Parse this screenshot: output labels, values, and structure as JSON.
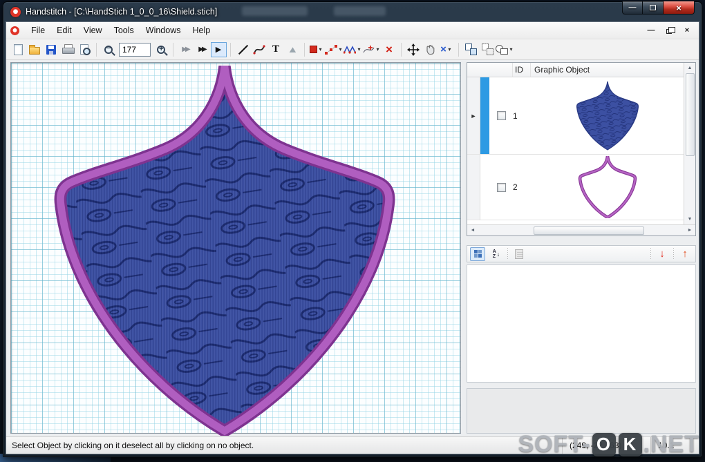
{
  "window": {
    "title": "Handstitch - [C:\\HandStich 1_0_0_16\\Shield.stich]",
    "minimize_glyph": "—",
    "close_glyph": "×"
  },
  "mdi": {
    "minimize_glyph": "—",
    "close_glyph": "×"
  },
  "menus": [
    "File",
    "Edit",
    "View",
    "Tools",
    "Windows",
    "Help"
  ],
  "toolbar": {
    "zoom_value": "177",
    "dropdown": "▾",
    "buttons": [
      {
        "name": "new-document"
      },
      {
        "name": "open-file"
      },
      {
        "name": "save-file"
      },
      {
        "name": "print"
      },
      {
        "name": "print-preview"
      },
      {
        "name": "zoom-out"
      },
      {
        "name": "zoom-in"
      },
      {
        "name": "step-backward",
        "glyph": "▶▶"
      },
      {
        "name": "step-forward",
        "glyph": "▶▶"
      },
      {
        "name": "play-selected",
        "glyph": "▶"
      },
      {
        "name": "line-tool"
      },
      {
        "name": "curve-tool"
      },
      {
        "name": "text-tool",
        "glyph": "T"
      },
      {
        "name": "polygon-tool",
        "glyph": "▲"
      },
      {
        "name": "fill-tool"
      },
      {
        "name": "node-edit-tool"
      },
      {
        "name": "stitch-tool"
      },
      {
        "name": "add-point-tool"
      },
      {
        "name": "delete-tool",
        "glyph": "×"
      },
      {
        "name": "move-tool"
      },
      {
        "name": "pan-tool"
      },
      {
        "name": "remove-object-tool",
        "glyph": "×"
      },
      {
        "name": "group-tool"
      },
      {
        "name": "ungroup-tool"
      },
      {
        "name": "shapes-tool"
      }
    ]
  },
  "object_panel": {
    "columns": {
      "id": "ID",
      "graphic": "Graphic Object"
    },
    "rows": [
      {
        "id": "1"
      },
      {
        "id": "2"
      }
    ],
    "current_row_marker": "►",
    "scroll": {
      "up": "▲",
      "down": "▼",
      "left": "◄",
      "right": "►"
    }
  },
  "property_panel": {
    "sort_a": "A",
    "sort_z": "Z",
    "sort_arrow": "↓",
    "move_down": "↓",
    "move_up": "↑"
  },
  "statusbar": {
    "message": "Select Object by clicking on it deselect all by clicking on no object.",
    "coords": "(249, -22.763)",
    "size": "10.1"
  },
  "watermark": {
    "left": "SOFT-",
    "o": "O",
    "k": "K",
    "right": ".NET"
  },
  "colors": {
    "shield_fill": "#3c50a2",
    "shield_pattern_line": "#1b2a6e",
    "border_purple": "#b05ec0",
    "border_purple_dark": "#7e3390",
    "selection_blue": "#2d9ae3",
    "accent_red": "#d32a1e"
  }
}
